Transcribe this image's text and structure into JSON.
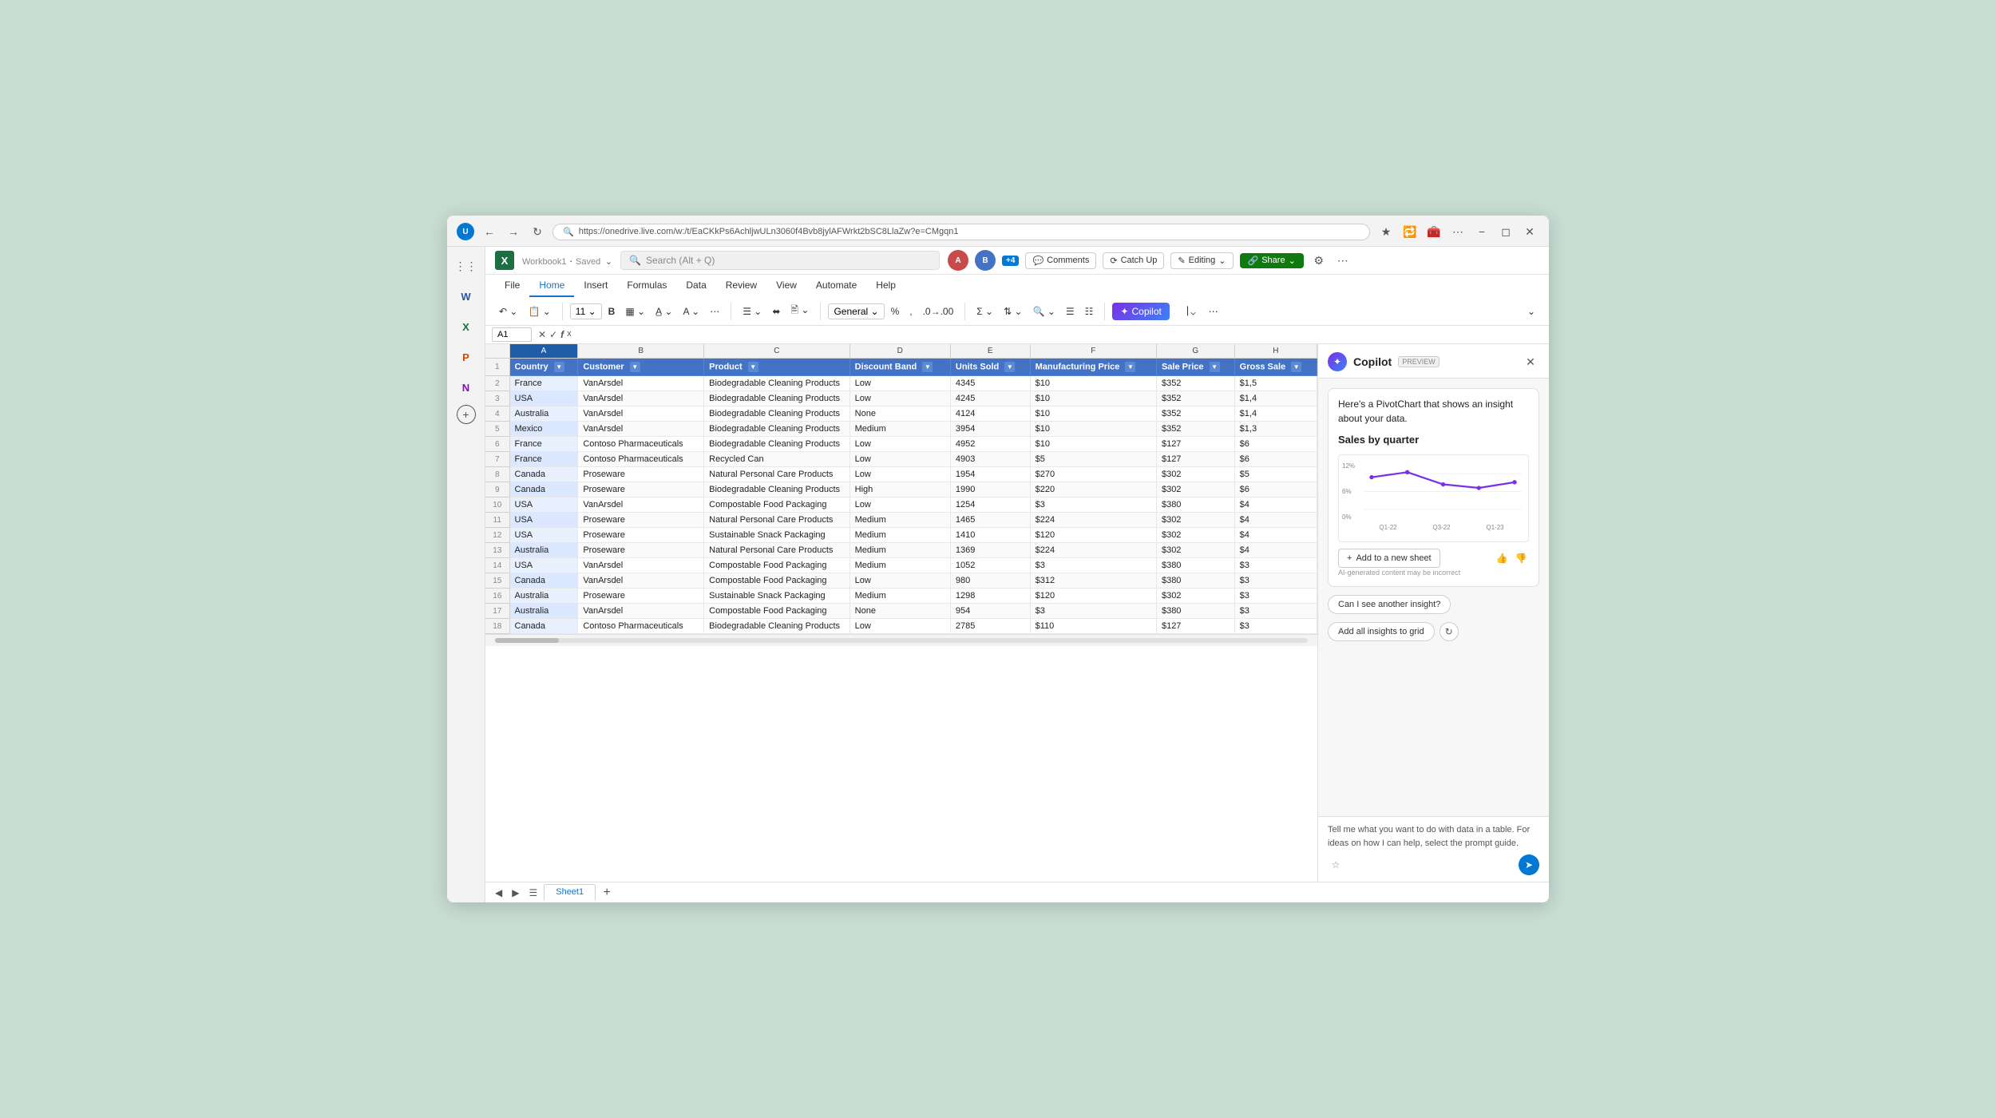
{
  "browser": {
    "url": "https://onedrive.live.com/w:/t/EaCKkPs6AchljwULn3060f4Bvb8jylAFWrkt2bSC8LlaZw?e=CMgqn1",
    "search_placeholder": "Search (Alt + Q)"
  },
  "app": {
    "title": "Workbook1",
    "saved_label": "Saved",
    "search_placeholder": "Search (Alt + Q)"
  },
  "ribbon": {
    "tabs": [
      "File",
      "Home",
      "Insert",
      "Formulas",
      "Data",
      "Review",
      "View",
      "Automate",
      "Help"
    ],
    "active_tab": "Home",
    "comments_label": "Comments",
    "catchup_label": "Catch Up",
    "editing_label": "Editing",
    "share_label": "Share"
  },
  "formula_bar": {
    "cell_ref": "A1"
  },
  "spreadsheet": {
    "columns": [
      "A",
      "B",
      "C",
      "D",
      "E",
      "F",
      "G",
      "H"
    ],
    "headers": [
      "Country",
      "Customer",
      "Product",
      "Discount Band",
      "Units Sold",
      "Manufacturing Price",
      "Sale Price",
      "Gross Sale"
    ],
    "rows": [
      [
        "France",
        "VanArsdel",
        "Biodegradable Cleaning Products",
        "Low",
        "4345",
        "$10",
        "$352",
        "$1,5"
      ],
      [
        "USA",
        "VanArsdel",
        "Biodegradable Cleaning Products",
        "Low",
        "4245",
        "$10",
        "$352",
        "$1,4"
      ],
      [
        "Australia",
        "VanArsdel",
        "Biodegradable Cleaning Products",
        "None",
        "4124",
        "$10",
        "$352",
        "$1,4"
      ],
      [
        "Mexico",
        "VanArsdel",
        "Biodegradable Cleaning Products",
        "Medium",
        "3954",
        "$10",
        "$352",
        "$1,3"
      ],
      [
        "France",
        "Contoso Pharmaceuticals",
        "Biodegradable Cleaning Products",
        "Low",
        "4952",
        "$10",
        "$127",
        "$6"
      ],
      [
        "France",
        "Contoso Pharmaceuticals",
        "Recycled Can",
        "Low",
        "4903",
        "$5",
        "$127",
        "$6"
      ],
      [
        "Canada",
        "Proseware",
        "Natural Personal Care Products",
        "Low",
        "1954",
        "$270",
        "$302",
        "$5"
      ],
      [
        "Canada",
        "Proseware",
        "Biodegradable Cleaning Products",
        "High",
        "1990",
        "$220",
        "$302",
        "$6"
      ],
      [
        "USA",
        "VanArsdel",
        "Compostable Food Packaging",
        "Low",
        "1254",
        "$3",
        "$380",
        "$4"
      ],
      [
        "USA",
        "Proseware",
        "Natural Personal Care Products",
        "Medium",
        "1465",
        "$224",
        "$302",
        "$4"
      ],
      [
        "USA",
        "Proseware",
        "Sustainable Snack Packaging",
        "Medium",
        "1410",
        "$120",
        "$302",
        "$4"
      ],
      [
        "Australia",
        "Proseware",
        "Natural Personal Care Products",
        "Medium",
        "1369",
        "$224",
        "$302",
        "$4"
      ],
      [
        "USA",
        "VanArsdel",
        "Compostable Food Packaging",
        "Medium",
        "1052",
        "$3",
        "$380",
        "$3"
      ],
      [
        "Canada",
        "VanArsdel",
        "Compostable Food Packaging",
        "Low",
        "980",
        "$312",
        "$380",
        "$3"
      ],
      [
        "Australia",
        "Proseware",
        "Sustainable Snack Packaging",
        "Medium",
        "1298",
        "$120",
        "$302",
        "$3"
      ],
      [
        "Australia",
        "VanArsdel",
        "Compostable Food Packaging",
        "None",
        "954",
        "$3",
        "$380",
        "$3"
      ],
      [
        "Canada",
        "Contoso Pharmaceuticals",
        "Biodegradable Cleaning Products",
        "Low",
        "2785",
        "$110",
        "$127",
        "$3"
      ]
    ],
    "row_numbers": [
      1,
      2,
      3,
      4,
      5,
      6,
      7,
      8,
      9,
      10,
      11,
      12,
      13,
      14,
      15,
      16,
      17,
      18
    ]
  },
  "sheet_tabs": {
    "tabs": [
      "Sheet1"
    ],
    "active_tab": "Sheet1"
  },
  "copilot": {
    "title": "Copilot",
    "preview_badge": "PREVIEW",
    "message": "Here's a PivotChart that shows an insight about your data.",
    "chart_title": "Sales by quarter",
    "chart_y_labels": [
      "12%",
      "6%",
      "0%"
    ],
    "chart_x_labels": [
      "Q1-22",
      "Q3-22",
      "Q1-23"
    ],
    "add_to_sheet_label": "Add to a new sheet",
    "ai_disclaimer": "AI-generated content may be incorrect",
    "suggestion1": "Can I see another insight?",
    "add_insights_label": "Add all insights to grid",
    "input_placeholder": "Tell me what you want to do with data in a table. For ideas on how I can help, select the prompt guide."
  }
}
